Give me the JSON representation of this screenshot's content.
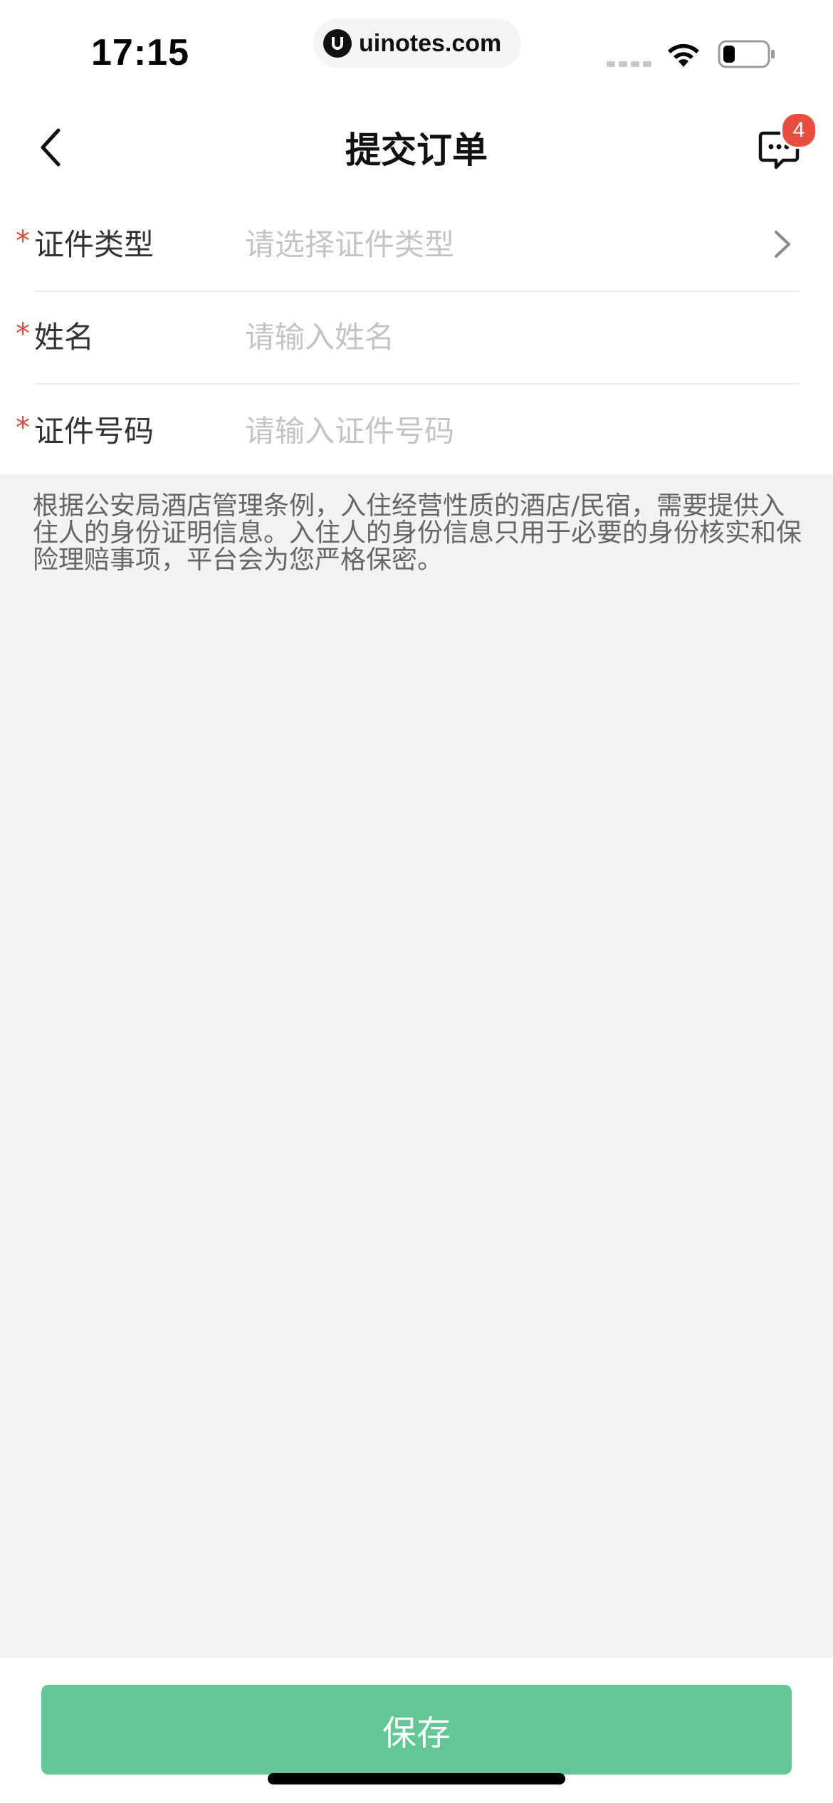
{
  "status_bar": {
    "time": "17:15",
    "url": "uinotes.com"
  },
  "nav": {
    "title": "提交订单",
    "message_badge": "4"
  },
  "form": {
    "rows": [
      {
        "required_mark": "*",
        "label": "证件类型",
        "placeholder": "请选择证件类型",
        "value": ""
      },
      {
        "required_mark": "*",
        "label": "姓名",
        "placeholder": "请输入姓名",
        "value": ""
      },
      {
        "required_mark": "*",
        "label": "证件号码",
        "placeholder": "请输入证件号码",
        "value": ""
      }
    ]
  },
  "notice": "根据公安局酒店管理条例，入住经营性质的酒店/民宿，需要提供入住人的身份证明信息。入住人的身份信息只用于必要的身份核实和保险理赔事项，平台会为您严格保密。",
  "actions": {
    "save_label": "保存"
  },
  "colors": {
    "accent_green": "#62c794",
    "badge_red": "#e84e40",
    "required_red": "#e04b3a"
  },
  "icons": [
    "back-icon",
    "message-icon",
    "chevron-right-icon",
    "wifi-icon",
    "battery-icon",
    "signal-icon"
  ]
}
